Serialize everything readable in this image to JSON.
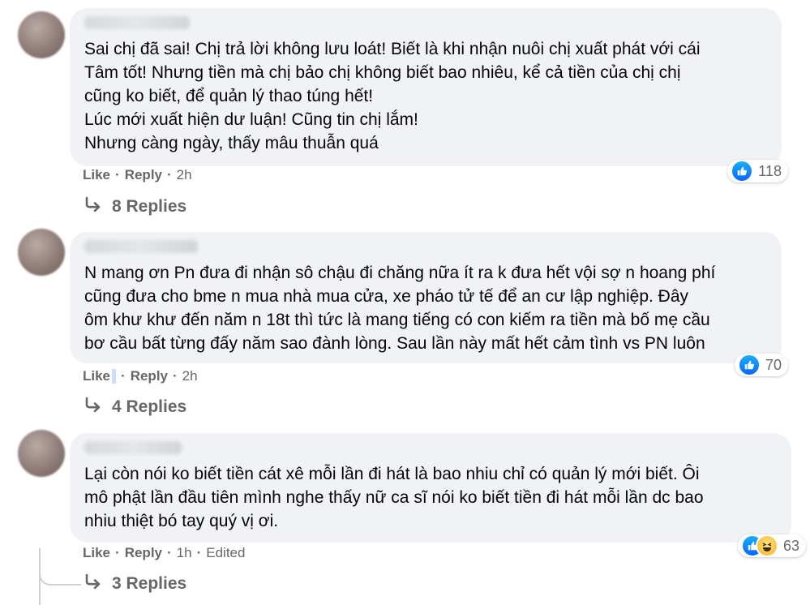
{
  "comments": [
    {
      "lines": [
        "Sai chị đã sai! Chị trả lời không lưu loát! Biết là khi nhận nuôi chị xuất phát với cái",
        "Tâm tốt! Nhưng tiền mà chị bảo chị không biết bao nhiêu, kể cả tiền của chị chị",
        "cũng ko biết, để quản lý thao túng hết!",
        "Lúc mới xuất hiện dư luận! Cũng tin chị lắm!",
        "Nhưng càng ngày, thấy mâu thuẫn quá"
      ],
      "reaction_count": "118",
      "like_label": "Like",
      "reply_label": "Reply",
      "time": "2h",
      "replies_label": "8 Replies"
    },
    {
      "lines": [
        "N mang ơn Pn đưa đi nhận sô chậu đi chăng nữa ít ra k đưa hết vội sợ n hoang phí",
        "cũng đưa cho bme n mua nhà mua cửa, xe pháo tử tế để an cư lập nghiệp. Đây",
        "ôm khư khư đến năm n 18t thì tức là mang tiếng có con kiếm ra tiền mà bố mẹ cầu",
        "bơ cầu bất từng đấy năm sao đành lòng. Sau lần này mất hết cảm tình vs PN luôn"
      ],
      "reaction_count": "70",
      "like_label": "Like",
      "reply_label": "Reply",
      "time": "2h",
      "replies_label": "4 Replies"
    },
    {
      "lines": [
        "Lại còn nói ko biết tiền cát xê mỗi lần đi hát là bao nhiu chỉ có quản lý mới biết. Ôi",
        "mô phật lần đầu tiên mình nghe thấy nữ ca sĩ nói ko biết tiền đi hát mỗi lần dc bao",
        "nhiu thiệt bó tay quý vị ơi."
      ],
      "reaction_count": "63",
      "like_label": "Like",
      "reply_label": "Reply",
      "time": "1h",
      "edited_label": "Edited",
      "replies_label": "3 Replies"
    }
  ],
  "colors": {
    "bubble": "#f0f2f5",
    "meta_text": "#65676b",
    "like_blue": "#0866ff"
  },
  "icons": {
    "like": "thumbs-up-icon",
    "haha": "haha-emoji-icon",
    "reply_arrow": "reply-arrow-icon"
  }
}
